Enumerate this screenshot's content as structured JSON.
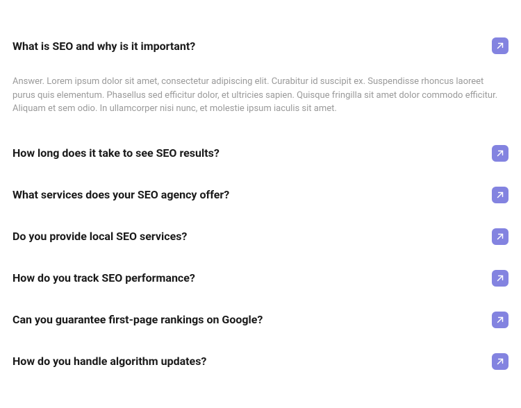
{
  "accent_color": "#8383e0",
  "faq": [
    {
      "question": "What is SEO and why is it important?",
      "expanded": true,
      "answer": "Answer. Lorem ipsum dolor sit amet, consectetur adipiscing elit. Curabitur id suscipit ex. Suspendisse rhoncus laoreet purus quis elementum. Phasellus sed efficitur dolor, et ultricies sapien. Quisque fringilla sit amet dolor commodo efficitur. Aliquam et sem odio. In ullamcorper nisi nunc, et molestie ipsum iaculis sit amet."
    },
    {
      "question": "How long does it take to see SEO results?",
      "expanded": false
    },
    {
      "question": "What services does your SEO agency offer?",
      "expanded": false
    },
    {
      "question": "Do you provide local SEO services?",
      "expanded": false
    },
    {
      "question": "How do you track SEO performance?",
      "expanded": false
    },
    {
      "question": "Can you guarantee first-page rankings on Google?",
      "expanded": false
    },
    {
      "question": "How do you handle algorithm updates?",
      "expanded": false
    }
  ]
}
